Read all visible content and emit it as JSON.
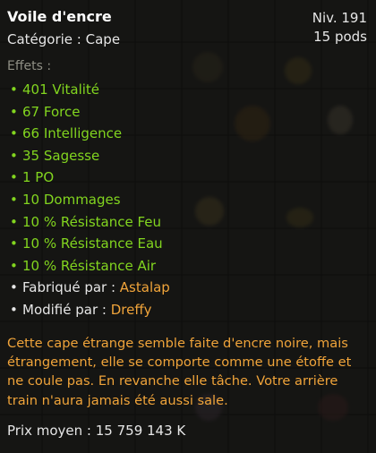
{
  "item": {
    "name": "Voile d'encre",
    "category": "Catégorie : Cape",
    "level": "Niv. 191",
    "weight": "15 pods"
  },
  "effects_label": "Effets :",
  "effects": [
    "401 Vitalité",
    "67 Force",
    "66 Intelligence",
    "35 Sagesse",
    "1 PO",
    "10 Dommages",
    "10 % Résistance Feu",
    "10 % Résistance Eau",
    "10 % Résistance Air"
  ],
  "crafts": [
    {
      "label": "Fabriqué par : ",
      "name": "Astalap"
    },
    {
      "label": "Modifié par : ",
      "name": "Dreffy"
    }
  ],
  "description": "Cette cape étrange semble faite d'encre noire, mais étrangement, elle se comporte comme une étoffe et ne coule pas. En revanche elle tâche. Votre arrière train n'aura jamais été aussi sale.",
  "price": "Prix moyen : 15 759 143 K",
  "colors": {
    "effect_green": "#82d51f",
    "accent_orange": "#f0a43a",
    "text_white": "#e6e6e6",
    "label_gray": "#8f8f85"
  }
}
